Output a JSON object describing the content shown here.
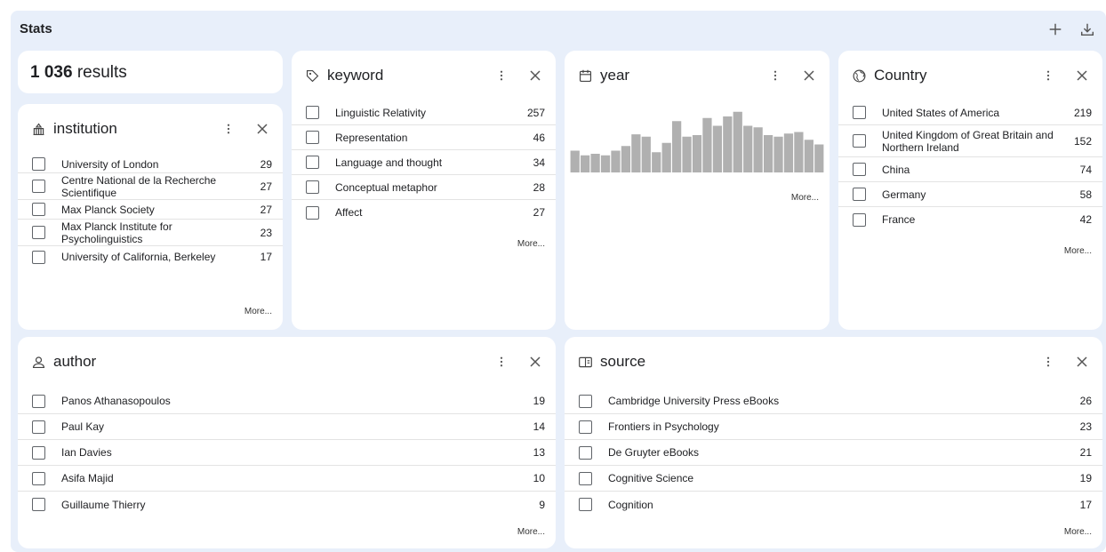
{
  "header": {
    "title": "Stats",
    "add_icon": "plus-icon",
    "download_icon": "download-icon"
  },
  "results": {
    "count": "1 036",
    "label": " results"
  },
  "institution": {
    "title": "institution",
    "icon": "institution-icon",
    "items": [
      {
        "label": "University of London",
        "count": "29"
      },
      {
        "label": "Centre National de la Recherche Scientifique",
        "count": "27"
      },
      {
        "label": "Max Planck Society",
        "count": "27"
      },
      {
        "label": "Max Planck Institute for Psycholinguistics",
        "count": "23"
      },
      {
        "label": "University of California, Berkeley",
        "count": "17"
      }
    ],
    "more": "More..."
  },
  "keyword": {
    "title": "keyword",
    "icon": "tag-icon",
    "items": [
      {
        "label": "Linguistic Relativity",
        "count": "257"
      },
      {
        "label": "Representation",
        "count": "46"
      },
      {
        "label": "Language and thought",
        "count": "34"
      },
      {
        "label": "Conceptual metaphor",
        "count": "28"
      },
      {
        "label": "Affect",
        "count": "27"
      }
    ],
    "more": "More..."
  },
  "year": {
    "title": "year",
    "icon": "calendar-icon",
    "more": "More...",
    "bar_color": "#b0b0b0"
  },
  "country": {
    "title": "Country",
    "icon": "globe-icon",
    "items": [
      {
        "label": "United States of America",
        "count": "219"
      },
      {
        "label": "United Kingdom of Great Britain and Northern Ireland",
        "count": "152"
      },
      {
        "label": "China",
        "count": "74"
      },
      {
        "label": "Germany",
        "count": "58"
      },
      {
        "label": "France",
        "count": "42"
      }
    ],
    "more": "More..."
  },
  "author": {
    "title": "author",
    "icon": "person-icon",
    "items": [
      {
        "label": "Panos Athanasopoulos",
        "count": "19"
      },
      {
        "label": "Paul Kay",
        "count": "14"
      },
      {
        "label": "Ian Davies",
        "count": "13"
      },
      {
        "label": "Asifa Majid",
        "count": "10"
      },
      {
        "label": "Guillaume Thierry",
        "count": "9"
      }
    ],
    "more": "More..."
  },
  "source": {
    "title": "source",
    "icon": "book-icon",
    "items": [
      {
        "label": "Cambridge University Press eBooks",
        "count": "26"
      },
      {
        "label": "Frontiers in Psychology",
        "count": "23"
      },
      {
        "label": "De Gruyter eBooks",
        "count": "21"
      },
      {
        "label": "Cognitive Science",
        "count": "19"
      },
      {
        "label": "Cognition",
        "count": "17"
      }
    ],
    "more": "More..."
  },
  "chart_data": {
    "type": "bar",
    "values": [
      28,
      22,
      24,
      22,
      28,
      34,
      49,
      46,
      26,
      38,
      66,
      46,
      48,
      70,
      60,
      72,
      78,
      60,
      58,
      48,
      46,
      50,
      52,
      42,
      36
    ],
    "ylim": [
      0,
      80
    ],
    "grid": false,
    "title": "",
    "xlabel": "",
    "ylabel": ""
  }
}
